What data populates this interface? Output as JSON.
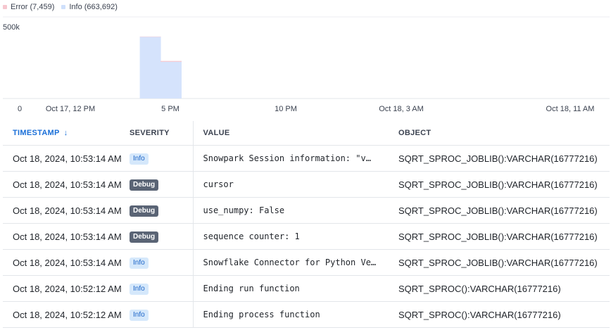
{
  "legend": [
    {
      "label": "Error (7,459)",
      "color": "#f6c7cf"
    },
    {
      "label": "Info (663,692)",
      "color": "#cfe0fb"
    }
  ],
  "chart_data": {
    "type": "bar",
    "stacked": true,
    "y_ticks": [
      "500k",
      "0"
    ],
    "ylim": [
      0,
      500000
    ],
    "x_ticks": [
      "Oct 17, 12 PM",
      "5 PM",
      "10 PM",
      "Oct 18, 3 AM",
      "Oct 18, 11 AM"
    ],
    "x_range_hours": [
      0,
      23
    ],
    "series": [
      {
        "name": "Info",
        "color": "#d5e3fc",
        "values": [
          420000,
          250000
        ]
      },
      {
        "name": "Error",
        "color": "#f4c2cb",
        "values": [
          2000,
          5459
        ]
      }
    ],
    "bar_times_hours": [
      4.0,
      5.0
    ],
    "grid": true
  },
  "table": {
    "headers": {
      "timestamp": "TIMESTAMP",
      "severity": "SEVERITY",
      "value": "VALUE",
      "object": "OBJECT"
    },
    "sort_arrow": "↓",
    "rows": [
      {
        "timestamp": "Oct 18, 2024, 10:53:14 AM",
        "severity": "Info",
        "level": "info",
        "value": "Snowpark Session information: \"v…",
        "object": "SQRT_SPROC_JOBLIB():VARCHAR(16777216)"
      },
      {
        "timestamp": "Oct 18, 2024, 10:53:14 AM",
        "severity": "Debug",
        "level": "debug",
        "value": "cursor",
        "object": "SQRT_SPROC_JOBLIB():VARCHAR(16777216)"
      },
      {
        "timestamp": "Oct 18, 2024, 10:53:14 AM",
        "severity": "Debug",
        "level": "debug",
        "value": "use_numpy: False",
        "object": "SQRT_SPROC_JOBLIB():VARCHAR(16777216)"
      },
      {
        "timestamp": "Oct 18, 2024, 10:53:14 AM",
        "severity": "Debug",
        "level": "debug",
        "value": "sequence counter: 1",
        "object": "SQRT_SPROC_JOBLIB():VARCHAR(16777216)"
      },
      {
        "timestamp": "Oct 18, 2024, 10:53:14 AM",
        "severity": "Info",
        "level": "info",
        "value": "Snowflake Connector for Python Ve…",
        "object": "SQRT_SPROC_JOBLIB():VARCHAR(16777216)"
      },
      {
        "timestamp": "Oct 18, 2024, 10:52:12 AM",
        "severity": "Info",
        "level": "info",
        "value": "Ending run function",
        "object": "SQRT_SPROC():VARCHAR(16777216)"
      },
      {
        "timestamp": "Oct 18, 2024, 10:52:12 AM",
        "severity": "Info",
        "level": "info",
        "value": "Ending process function",
        "object": "SQRT_SPROC():VARCHAR(16777216)"
      }
    ]
  }
}
